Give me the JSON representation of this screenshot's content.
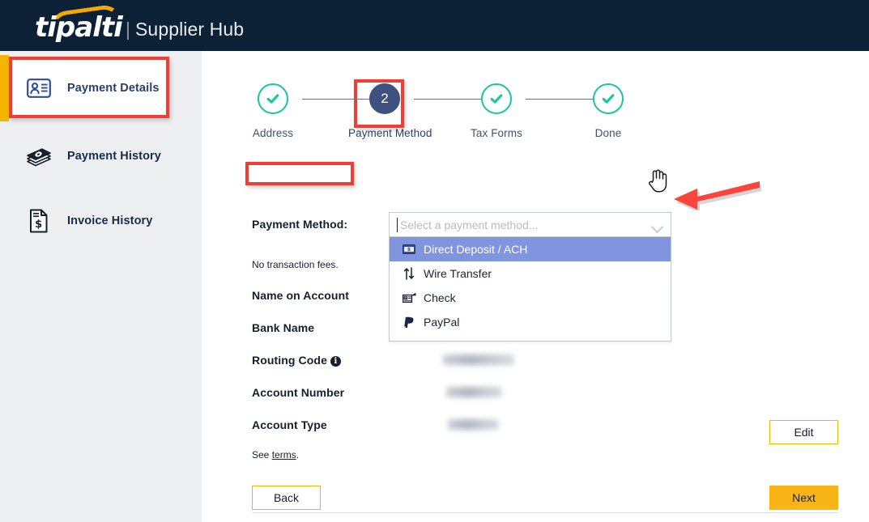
{
  "header": {
    "brand": "tipalti",
    "divider": "|",
    "product": "Supplier Hub"
  },
  "sidebar": {
    "items": [
      {
        "label": "Payment Details",
        "icon": "id-card-icon",
        "active": true
      },
      {
        "label": "Payment History",
        "icon": "money-stack-icon",
        "active": false
      },
      {
        "label": "Invoice History",
        "icon": "invoice-document-icon",
        "active": false
      }
    ]
  },
  "stepper": {
    "steps": [
      {
        "label": "Address",
        "state": "done",
        "marker": "check"
      },
      {
        "label": "Payment Method",
        "state": "current",
        "marker": "2"
      },
      {
        "label": "Tax Forms",
        "state": "done",
        "marker": "check"
      },
      {
        "label": "Done",
        "state": "done",
        "marker": "check"
      }
    ]
  },
  "form": {
    "payment_method_label": "Payment Method:",
    "combo_placeholder": "Select a payment method...",
    "combo_value": "",
    "fee_note": "No transaction fees.",
    "fields": [
      {
        "label": "Name on Account",
        "value": "",
        "redacted": false
      },
      {
        "label": "Bank Name",
        "value": "",
        "redacted": false
      },
      {
        "label": "Routing Code",
        "value": "",
        "redacted": true,
        "info": true
      },
      {
        "label": "Account Number",
        "value": "",
        "redacted": true
      },
      {
        "label": "Account Type",
        "value": "",
        "redacted": true
      }
    ],
    "terms_prefix": "See ",
    "terms_link": "terms",
    "terms_suffix": "."
  },
  "dropdown": {
    "open": true,
    "options": [
      {
        "label": "Direct Deposit / ACH",
        "icon": "bank-card-icon",
        "selected": true
      },
      {
        "label": "Wire Transfer",
        "icon": "up-down-arrows-icon",
        "selected": false
      },
      {
        "label": "Check",
        "icon": "cheque-icon",
        "selected": false
      },
      {
        "label": "PayPal",
        "icon": "paypal-icon",
        "selected": false
      }
    ]
  },
  "buttons": {
    "edit": "Edit",
    "back": "Back",
    "next": "Next"
  },
  "colors": {
    "header_bg": "#0d2136",
    "brand_yellow": "#f5b400",
    "accent_navy": "#2b3f6b",
    "step_done_green": "#18c79a",
    "step_current": "#3e5180",
    "option_highlight": "#8094e0",
    "annotation_red": "#ef3e36",
    "sidebar_bg": "#eeeff1"
  }
}
